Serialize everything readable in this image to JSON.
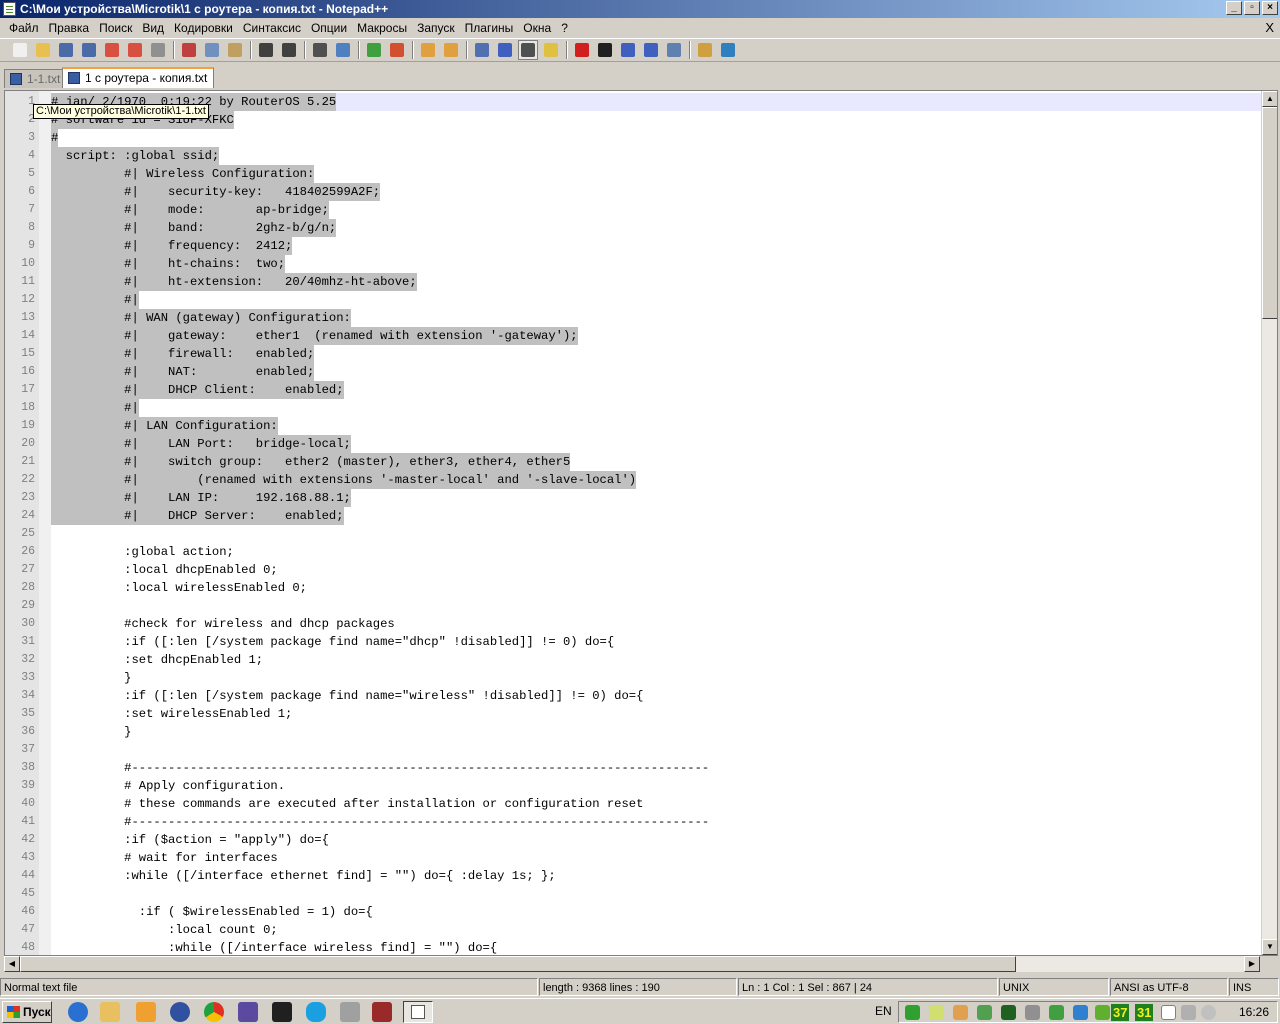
{
  "window": {
    "title": "C:\\Мои устройства\\Microtik\\1 с роутера - копия.txt - Notepad++",
    "buttons": [
      "_",
      "▫",
      "×"
    ]
  },
  "menu": {
    "items": [
      "Файл",
      "Правка",
      "Поиск",
      "Вид",
      "Кодировки",
      "Синтаксис",
      "Опции",
      "Макросы",
      "Запуск",
      "Плагины",
      "Окна",
      "?"
    ],
    "close": "X"
  },
  "toolbar": {
    "icons": [
      {
        "name": "new-file-icon",
        "color": "#f0f0f0"
      },
      {
        "name": "open-file-icon",
        "color": "#e8c050"
      },
      {
        "name": "save-icon",
        "color": "#4a6aa8"
      },
      {
        "name": "save-all-icon",
        "color": "#4a6aa8"
      },
      {
        "name": "close-icon",
        "color": "#d85040"
      },
      {
        "name": "close-all-icon",
        "color": "#d85040"
      },
      {
        "name": "print-icon",
        "color": "#909090"
      },
      {
        "sep": true
      },
      {
        "name": "cut-icon",
        "color": "#c04040"
      },
      {
        "name": "copy-icon",
        "color": "#7090c0"
      },
      {
        "name": "paste-icon",
        "color": "#c0a060"
      },
      {
        "sep": true
      },
      {
        "name": "undo-icon",
        "color": "#404040"
      },
      {
        "name": "redo-icon",
        "color": "#404040"
      },
      {
        "sep": true
      },
      {
        "name": "find-icon",
        "color": "#505050"
      },
      {
        "name": "replace-icon",
        "color": "#5080c0"
      },
      {
        "sep": true
      },
      {
        "name": "zoom-in-icon",
        "color": "#40a040"
      },
      {
        "name": "zoom-out-icon",
        "color": "#d05030"
      },
      {
        "sep": true
      },
      {
        "name": "sync-vertical-icon",
        "color": "#e0a040"
      },
      {
        "name": "sync-horizontal-icon",
        "color": "#e0a040"
      },
      {
        "sep": true
      },
      {
        "name": "word-wrap-icon",
        "color": "#5070b0"
      },
      {
        "name": "show-all-chars-icon",
        "color": "#4060c0"
      },
      {
        "name": "indent-guide-icon",
        "color": "#505050",
        "active": true
      },
      {
        "name": "user-lang-icon",
        "color": "#e0c040"
      },
      {
        "sep": true
      },
      {
        "name": "record-macro-icon",
        "color": "#d02020"
      },
      {
        "name": "stop-macro-icon",
        "color": "#202020"
      },
      {
        "name": "play-macro-icon",
        "color": "#4060c0"
      },
      {
        "name": "run-macro-multiple-icon",
        "color": "#4060c0"
      },
      {
        "name": "save-macro-icon",
        "color": "#6080b0"
      },
      {
        "sep": true
      },
      {
        "name": "plugin-explorer-icon",
        "color": "#d0a040"
      },
      {
        "name": "spellcheck-icon",
        "color": "#3080c0"
      }
    ]
  },
  "tabs": [
    {
      "label": "1-1.txt",
      "active": false
    },
    {
      "label": "1 с роутера - копия.txt",
      "active": true
    }
  ],
  "tooltip": "C:\\Мои устройства\\Microtik\\1-1.txt",
  "editor": {
    "lines": [
      {
        "n": "1",
        "text": "# jan/ 2/1970  0:19:22 by RouterOS 5.25",
        "sel": true,
        "current": true
      },
      {
        "n": "2",
        "text": "# software id = S1UF-XFKC",
        "sel": true
      },
      {
        "n": "3",
        "text": "#",
        "sel": true
      },
      {
        "n": "4",
        "text": "  script: :global ssid;",
        "sel": true
      },
      {
        "n": "5",
        "text": "          #| Wireless Configuration:",
        "sel": true
      },
      {
        "n": "6",
        "text": "          #|    security-key:   418402599A2F;",
        "sel": true
      },
      {
        "n": "7",
        "text": "          #|    mode:       ap-bridge;",
        "sel": true
      },
      {
        "n": "8",
        "text": "          #|    band:       2ghz-b/g/n;",
        "sel": true
      },
      {
        "n": "9",
        "text": "          #|    frequency:  2412;",
        "sel": true
      },
      {
        "n": "10",
        "text": "          #|    ht-chains:  two;",
        "sel": true
      },
      {
        "n": "11",
        "text": "          #|    ht-extension:   20/40mhz-ht-above;",
        "sel": true
      },
      {
        "n": "12",
        "text": "          #|",
        "sel": true
      },
      {
        "n": "13",
        "text": "          #| WAN (gateway) Configuration:",
        "sel": true
      },
      {
        "n": "14",
        "text": "          #|    gateway:    ether1  (renamed with extension '-gateway');",
        "sel": true
      },
      {
        "n": "15",
        "text": "          #|    firewall:   enabled;",
        "sel": true
      },
      {
        "n": "16",
        "text": "          #|    NAT:        enabled;",
        "sel": true
      },
      {
        "n": "17",
        "text": "          #|    DHCP Client:    enabled;",
        "sel": true
      },
      {
        "n": "18",
        "text": "          #|",
        "sel": true
      },
      {
        "n": "19",
        "text": "          #| LAN Configuration:",
        "sel": true
      },
      {
        "n": "20",
        "text": "          #|    LAN Port:   bridge-local;",
        "sel": true
      },
      {
        "n": "21",
        "text": "          #|    switch group:   ether2 (master), ether3, ether4, ether5",
        "sel": true
      },
      {
        "n": "22",
        "text": "          #|        (renamed with extensions '-master-local' and '-slave-local')",
        "sel": true
      },
      {
        "n": "23",
        "text": "          #|    LAN IP:     192.168.88.1;",
        "sel": true
      },
      {
        "n": "24",
        "text": "          #|    DHCP Server:    enabled;",
        "sel": true
      },
      {
        "n": "25",
        "text": "",
        "sel": false
      },
      {
        "n": "26",
        "text": "          :global action;",
        "sel": false
      },
      {
        "n": "27",
        "text": "          :local dhcpEnabled 0;",
        "sel": false
      },
      {
        "n": "28",
        "text": "          :local wirelessEnabled 0;",
        "sel": false
      },
      {
        "n": "29",
        "text": "",
        "sel": false
      },
      {
        "n": "30",
        "text": "          #check for wireless and dhcp packages",
        "sel": false
      },
      {
        "n": "31",
        "text": "          :if ([:len [/system package find name=\"dhcp\" !disabled]] != 0) do={",
        "sel": false
      },
      {
        "n": "32",
        "text": "          :set dhcpEnabled 1;",
        "sel": false
      },
      {
        "n": "33",
        "text": "          }",
        "sel": false
      },
      {
        "n": "34",
        "text": "          :if ([:len [/system package find name=\"wireless\" !disabled]] != 0) do={",
        "sel": false
      },
      {
        "n": "35",
        "text": "          :set wirelessEnabled 1;",
        "sel": false
      },
      {
        "n": "36",
        "text": "          }",
        "sel": false
      },
      {
        "n": "37",
        "text": "",
        "sel": false
      },
      {
        "n": "38",
        "text": "          #-------------------------------------------------------------------------------",
        "sel": false
      },
      {
        "n": "39",
        "text": "          # Apply configuration.",
        "sel": false
      },
      {
        "n": "40",
        "text": "          # these commands are executed after installation or configuration reset",
        "sel": false
      },
      {
        "n": "41",
        "text": "          #-------------------------------------------------------------------------------",
        "sel": false
      },
      {
        "n": "42",
        "text": "          :if ($action = \"apply\") do={",
        "sel": false
      },
      {
        "n": "43",
        "text": "          # wait for interfaces",
        "sel": false
      },
      {
        "n": "44",
        "text": "          :while ([/interface ethernet find] = \"\") do={ :delay 1s; };",
        "sel": false
      },
      {
        "n": "45",
        "text": "",
        "sel": false
      },
      {
        "n": "46",
        "text": "            :if ( $wirelessEnabled = 1) do={",
        "sel": false
      },
      {
        "n": "47",
        "text": "                :local count 0;",
        "sel": false
      },
      {
        "n": "48",
        "text": "                :while ([/interface wireless find] = \"\") do={",
        "sel": false
      }
    ]
  },
  "status": {
    "type": "Normal text file",
    "length": "length : 9368    lines : 190",
    "position": "Ln : 1    Col : 1    Sel : 867 | 24",
    "eol": "UNIX",
    "encoding": "ANSI as UTF-8",
    "mode": "INS"
  },
  "taskbar": {
    "start": "Пуск",
    "language": "EN",
    "tray_numbers": [
      "37",
      "31"
    ],
    "clock": "16:26"
  }
}
